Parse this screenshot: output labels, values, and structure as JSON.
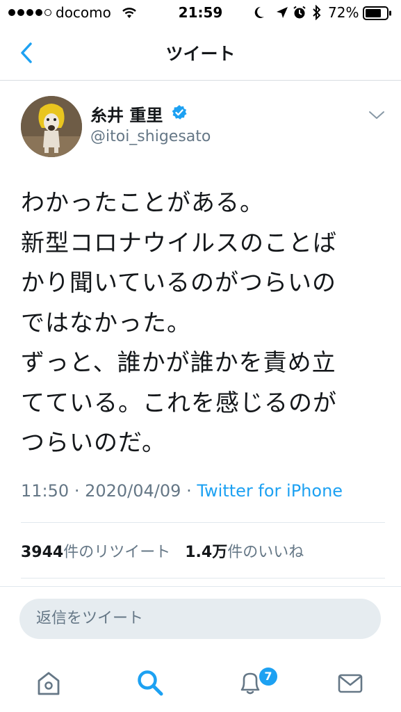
{
  "status_bar": {
    "carrier": "docomo",
    "time": "21:59",
    "battery": "72%"
  },
  "nav": {
    "title": "ツイート",
    "back_icon": "chevron-left-icon"
  },
  "tweet": {
    "display_name": "糸井 重里",
    "verified": true,
    "username": "@itoi_shigesato",
    "text": "わかったことがある。\n新型コロナウイルスのことば\nかり聞いているのがつらいの\nではなかった。\nずっと、誰かが誰かを責め立\nてている。これを感じるのが\nつらいのだ。",
    "time": "11:50",
    "date": "2020/04/09",
    "separator": "·",
    "source": "Twitter for iPhone",
    "retweets_count": "3944",
    "retweets_label": "件のリツイート",
    "likes_count": "1.4万",
    "likes_label": "件のいいね"
  },
  "reply": {
    "placeholder": "返信をツイート"
  },
  "tabs": [
    {
      "name": "home",
      "icon": "home-icon",
      "active": false
    },
    {
      "name": "search",
      "icon": "search-icon",
      "active": true
    },
    {
      "name": "notifications",
      "icon": "bell-icon",
      "active": false,
      "badge": "7"
    },
    {
      "name": "messages",
      "icon": "mail-icon",
      "active": false
    }
  ],
  "colors": {
    "accent": "#1da1f2",
    "secondary_text": "#657786",
    "primary_text": "#14171a",
    "divider": "#e1e8ed",
    "input_bg": "#e6ecf0"
  }
}
